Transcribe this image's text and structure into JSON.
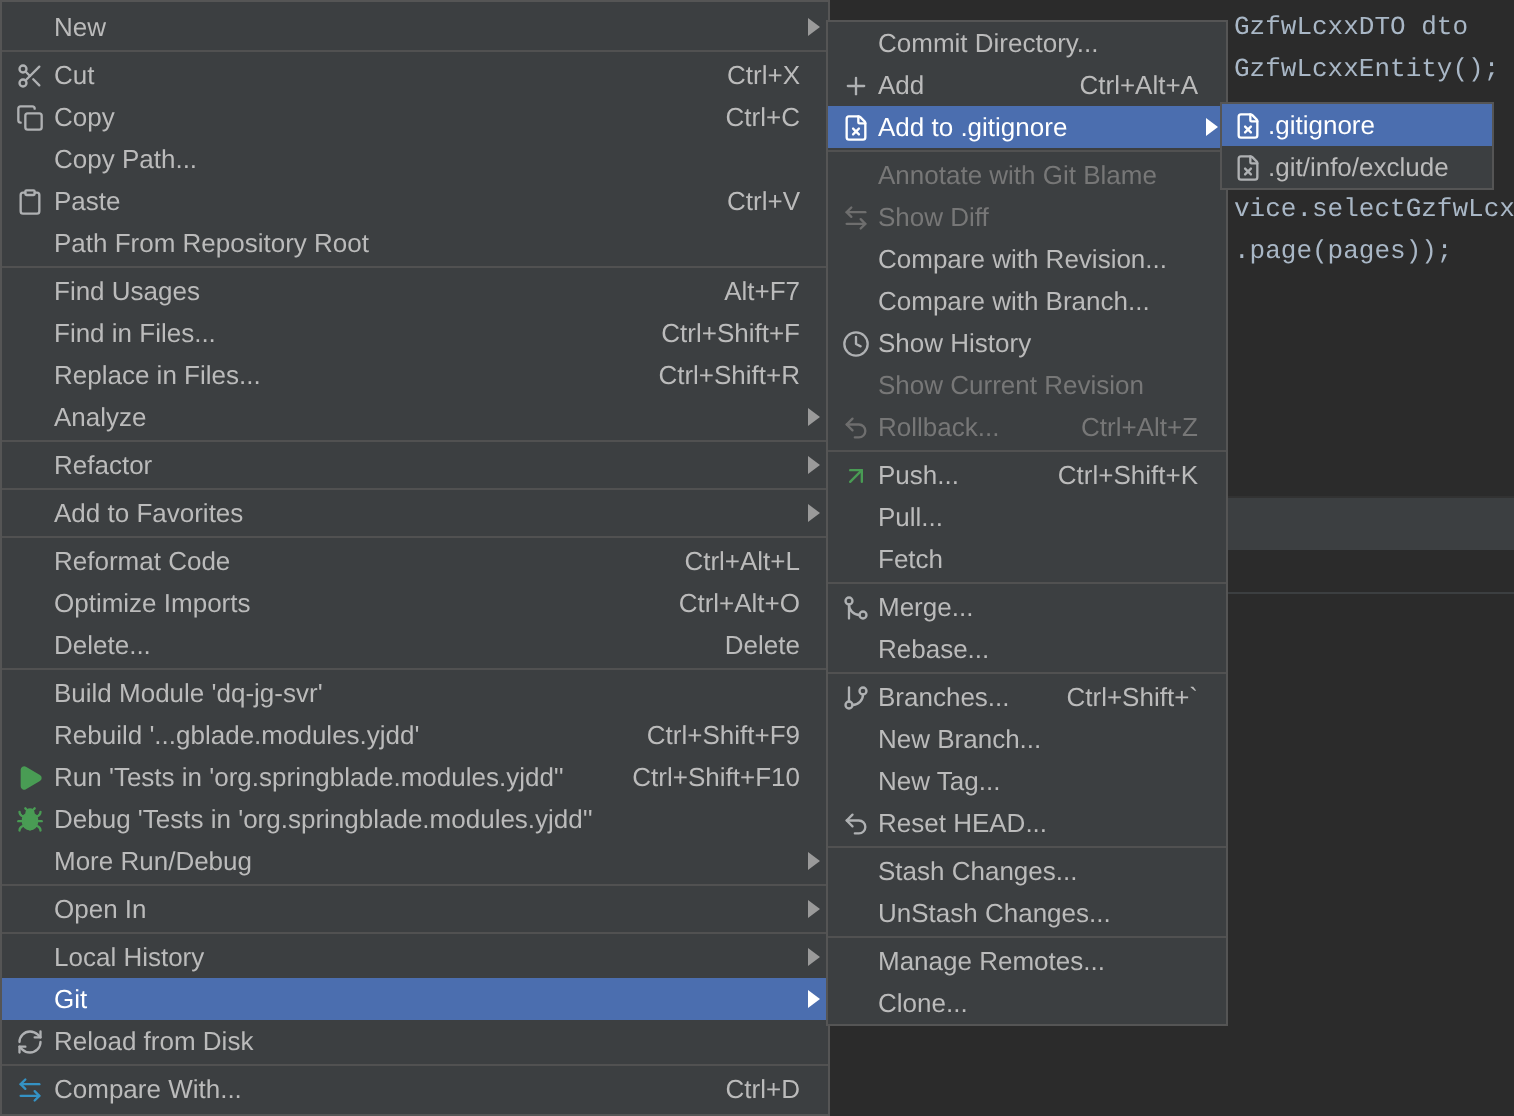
{
  "editor": {
    "code_lines": [
      {
        "text": "GzfwLcxxDTO dto"
      },
      {
        "text": "GzfwLcxxEntity();"
      },
      {
        "text": "vice.selectGzfwLcx"
      },
      {
        "text": ".page(pages));"
      }
    ]
  },
  "context_menu": {
    "items": [
      {
        "kind": "item",
        "label": "New",
        "submenu": true,
        "selected": false,
        "disabled": false
      },
      {
        "kind": "separator"
      },
      {
        "kind": "item",
        "label": "Cut",
        "shortcut": "Ctrl+X",
        "selected": false,
        "disabled": false
      },
      {
        "kind": "item",
        "label": "Copy",
        "shortcut": "Ctrl+C",
        "selected": false,
        "disabled": false
      },
      {
        "kind": "item",
        "label": "Copy Path...",
        "selected": false,
        "disabled": false
      },
      {
        "kind": "item",
        "label": "Paste",
        "shortcut": "Ctrl+V",
        "selected": false,
        "disabled": false
      },
      {
        "kind": "item",
        "label": "Path From Repository Root",
        "selected": false,
        "disabled": false
      },
      {
        "kind": "separator"
      },
      {
        "kind": "item",
        "label": "Find Usages",
        "shortcut": "Alt+F7",
        "selected": false,
        "disabled": false
      },
      {
        "kind": "item",
        "label": "Find in Files...",
        "shortcut": "Ctrl+Shift+F",
        "selected": false,
        "disabled": false
      },
      {
        "kind": "item",
        "label": "Replace in Files...",
        "shortcut": "Ctrl+Shift+R",
        "selected": false,
        "disabled": false
      },
      {
        "kind": "item",
        "label": "Analyze",
        "submenu": true,
        "selected": false,
        "disabled": false
      },
      {
        "kind": "separator"
      },
      {
        "kind": "item",
        "label": "Refactor",
        "submenu": true,
        "selected": false,
        "disabled": false
      },
      {
        "kind": "separator"
      },
      {
        "kind": "item",
        "label": "Add to Favorites",
        "submenu": true,
        "selected": false,
        "disabled": false
      },
      {
        "kind": "separator"
      },
      {
        "kind": "item",
        "label": "Reformat Code",
        "shortcut": "Ctrl+Alt+L",
        "selected": false,
        "disabled": false
      },
      {
        "kind": "item",
        "label": "Optimize Imports",
        "shortcut": "Ctrl+Alt+O",
        "selected": false,
        "disabled": false
      },
      {
        "kind": "item",
        "label": "Delete...",
        "shortcut": "Delete",
        "selected": false,
        "disabled": false
      },
      {
        "kind": "separator"
      },
      {
        "kind": "item",
        "label": "Build Module 'dq-jg-svr'",
        "selected": false,
        "disabled": false
      },
      {
        "kind": "item",
        "label": "Rebuild '...gblade.modules.yjdd'",
        "shortcut": "Ctrl+Shift+F9",
        "selected": false,
        "disabled": false
      },
      {
        "kind": "item",
        "label": "Run 'Tests in 'org.springblade.modules.yjdd''",
        "shortcut": "Ctrl+Shift+F10",
        "selected": false,
        "disabled": false
      },
      {
        "kind": "item",
        "label": "Debug 'Tests in 'org.springblade.modules.yjdd''",
        "selected": false,
        "disabled": false
      },
      {
        "kind": "item",
        "label": "More Run/Debug",
        "submenu": true,
        "selected": false,
        "disabled": false
      },
      {
        "kind": "separator"
      },
      {
        "kind": "item",
        "label": "Open In",
        "submenu": true,
        "selected": false,
        "disabled": false
      },
      {
        "kind": "separator"
      },
      {
        "kind": "item",
        "label": "Local History",
        "submenu": true,
        "selected": false,
        "disabled": false
      },
      {
        "kind": "item",
        "label": "Git",
        "submenu": true,
        "selected": true,
        "disabled": false
      },
      {
        "kind": "item",
        "label": "Reload from Disk",
        "selected": false,
        "disabled": false
      },
      {
        "kind": "separator"
      },
      {
        "kind": "item",
        "label": "Compare With...",
        "shortcut": "Ctrl+D",
        "selected": false,
        "disabled": false
      }
    ]
  },
  "git_submenu": {
    "items": [
      {
        "kind": "item",
        "label": "Commit Directory...",
        "selected": false,
        "disabled": false
      },
      {
        "kind": "item",
        "label": "Add",
        "shortcut": "Ctrl+Alt+A",
        "selected": false,
        "disabled": false
      },
      {
        "kind": "item",
        "label": "Add to .gitignore",
        "submenu": true,
        "selected": true,
        "disabled": false
      },
      {
        "kind": "separator"
      },
      {
        "kind": "item",
        "label": "Annotate with Git Blame",
        "selected": false,
        "disabled": true
      },
      {
        "kind": "item",
        "label": "Show Diff",
        "selected": false,
        "disabled": true
      },
      {
        "kind": "item",
        "label": "Compare with Revision...",
        "selected": false,
        "disabled": false
      },
      {
        "kind": "item",
        "label": "Compare with Branch...",
        "selected": false,
        "disabled": false
      },
      {
        "kind": "item",
        "label": "Show History",
        "selected": false,
        "disabled": false
      },
      {
        "kind": "item",
        "label": "Show Current Revision",
        "selected": false,
        "disabled": true
      },
      {
        "kind": "item",
        "label": "Rollback...",
        "shortcut": "Ctrl+Alt+Z",
        "selected": false,
        "disabled": true
      },
      {
        "kind": "separator"
      },
      {
        "kind": "item",
        "label": "Push...",
        "shortcut": "Ctrl+Shift+K",
        "selected": false,
        "disabled": false
      },
      {
        "kind": "item",
        "label": "Pull...",
        "selected": false,
        "disabled": false
      },
      {
        "kind": "item",
        "label": "Fetch",
        "selected": false,
        "disabled": false
      },
      {
        "kind": "separator"
      },
      {
        "kind": "item",
        "label": "Merge...",
        "selected": false,
        "disabled": false
      },
      {
        "kind": "item",
        "label": "Rebase...",
        "selected": false,
        "disabled": false
      },
      {
        "kind": "separator"
      },
      {
        "kind": "item",
        "label": "Branches...",
        "shortcut": "Ctrl+Shift+`",
        "selected": false,
        "disabled": false
      },
      {
        "kind": "item",
        "label": "New Branch...",
        "selected": false,
        "disabled": false
      },
      {
        "kind": "item",
        "label": "New Tag...",
        "selected": false,
        "disabled": false
      },
      {
        "kind": "item",
        "label": "Reset HEAD...",
        "selected": false,
        "disabled": false
      },
      {
        "kind": "separator"
      },
      {
        "kind": "item",
        "label": "Stash Changes...",
        "selected": false,
        "disabled": false
      },
      {
        "kind": "item",
        "label": "UnStash Changes...",
        "selected": false,
        "disabled": false
      },
      {
        "kind": "separator"
      },
      {
        "kind": "item",
        "label": "Manage Remotes...",
        "selected": false,
        "disabled": false
      },
      {
        "kind": "item",
        "label": "Clone...",
        "selected": false,
        "disabled": false
      }
    ]
  },
  "gitignore_submenu": {
    "items": [
      {
        "kind": "item",
        "label": ".gitignore",
        "selected": true,
        "disabled": false
      },
      {
        "kind": "item",
        "label": ".git/info/exclude",
        "selected": false,
        "disabled": false
      }
    ]
  }
}
